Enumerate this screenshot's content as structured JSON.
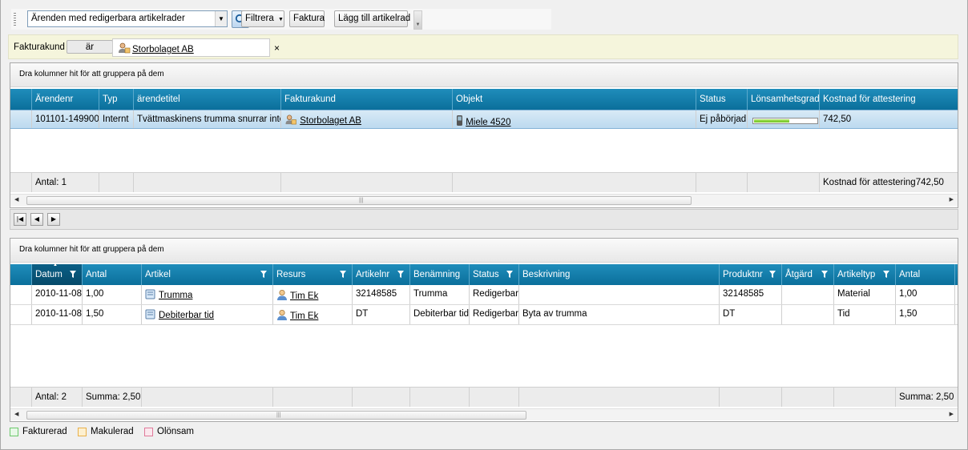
{
  "toolbar": {
    "view_select": "Ärenden med redigerbara artikelrader",
    "filter_button": "Filtrera",
    "invoice_button": "Faktura",
    "add_row_button": "Lägg till artikelrad"
  },
  "filter": {
    "field": "Fakturakund",
    "operator": "är",
    "value": "Storbolaget AB"
  },
  "cases_grid": {
    "group_hint": "Dra kolumner hit för att gruppera på dem",
    "columns": [
      "Ärendenr",
      "Typ",
      "ärendetitel",
      "Fakturakund",
      "Objekt",
      "Status",
      "Lönsamhetsgrad",
      "Kostnad för attestering"
    ],
    "rows": [
      {
        "case_no": "101101-149900",
        "type": "Internt",
        "title": "Tvättmaskinens trumma snurrar inte",
        "customer": "Storbolaget AB",
        "object": "Miele 4520",
        "status": "Ej påbörjad",
        "profitability": 0.55,
        "cost": "742,50"
      }
    ],
    "footer": {
      "count": "Antal: 1",
      "cost_summary": "Kostnad för attestering742,50"
    }
  },
  "rows_grid": {
    "group_hint": "Dra kolumner hit för att gruppera på dem",
    "columns": [
      "Datum",
      "Antal",
      "Artikel",
      "Resurs",
      "Artikelnr",
      "Benämning",
      "Status",
      "Beskrivning",
      "Produktnr",
      "Åtgärd",
      "Artikeltyp",
      "Antal"
    ],
    "rows": [
      {
        "date": "2010-11-08",
        "qty": "1,00",
        "article": "Trumma",
        "resource": "Tim Ek",
        "article_no": "32148585",
        "name": "Trumma",
        "status": "Redigerbar",
        "description": "",
        "product_no": "32148585",
        "action": "",
        "article_type": "Material",
        "qty2": "1,00"
      },
      {
        "date": "2010-11-08",
        "qty": "1,50",
        "article": "Debiterbar tid",
        "resource": "Tim Ek",
        "article_no": "DT",
        "name": "Debiterbar tid",
        "status": "Redigerbar",
        "description": "Byta av trumma",
        "product_no": "DT",
        "action": "",
        "article_type": "Tid",
        "qty2": "1,50"
      }
    ],
    "footer": {
      "count": "Antal: 2",
      "sum1": "Summa: 2,50",
      "sum2": "Summa: 2,50"
    }
  },
  "legend": [
    "Fakturerad",
    "Makulerad",
    "Olönsam"
  ],
  "colors": {
    "header": "#0b6f9b",
    "selected_row": "#bcd9ef",
    "filter_bar": "#f5f5dc",
    "legend_invoiced": "#6cc86c",
    "legend_voided": "#e8b04a",
    "legend_unprofitable": "#e07a9a"
  }
}
